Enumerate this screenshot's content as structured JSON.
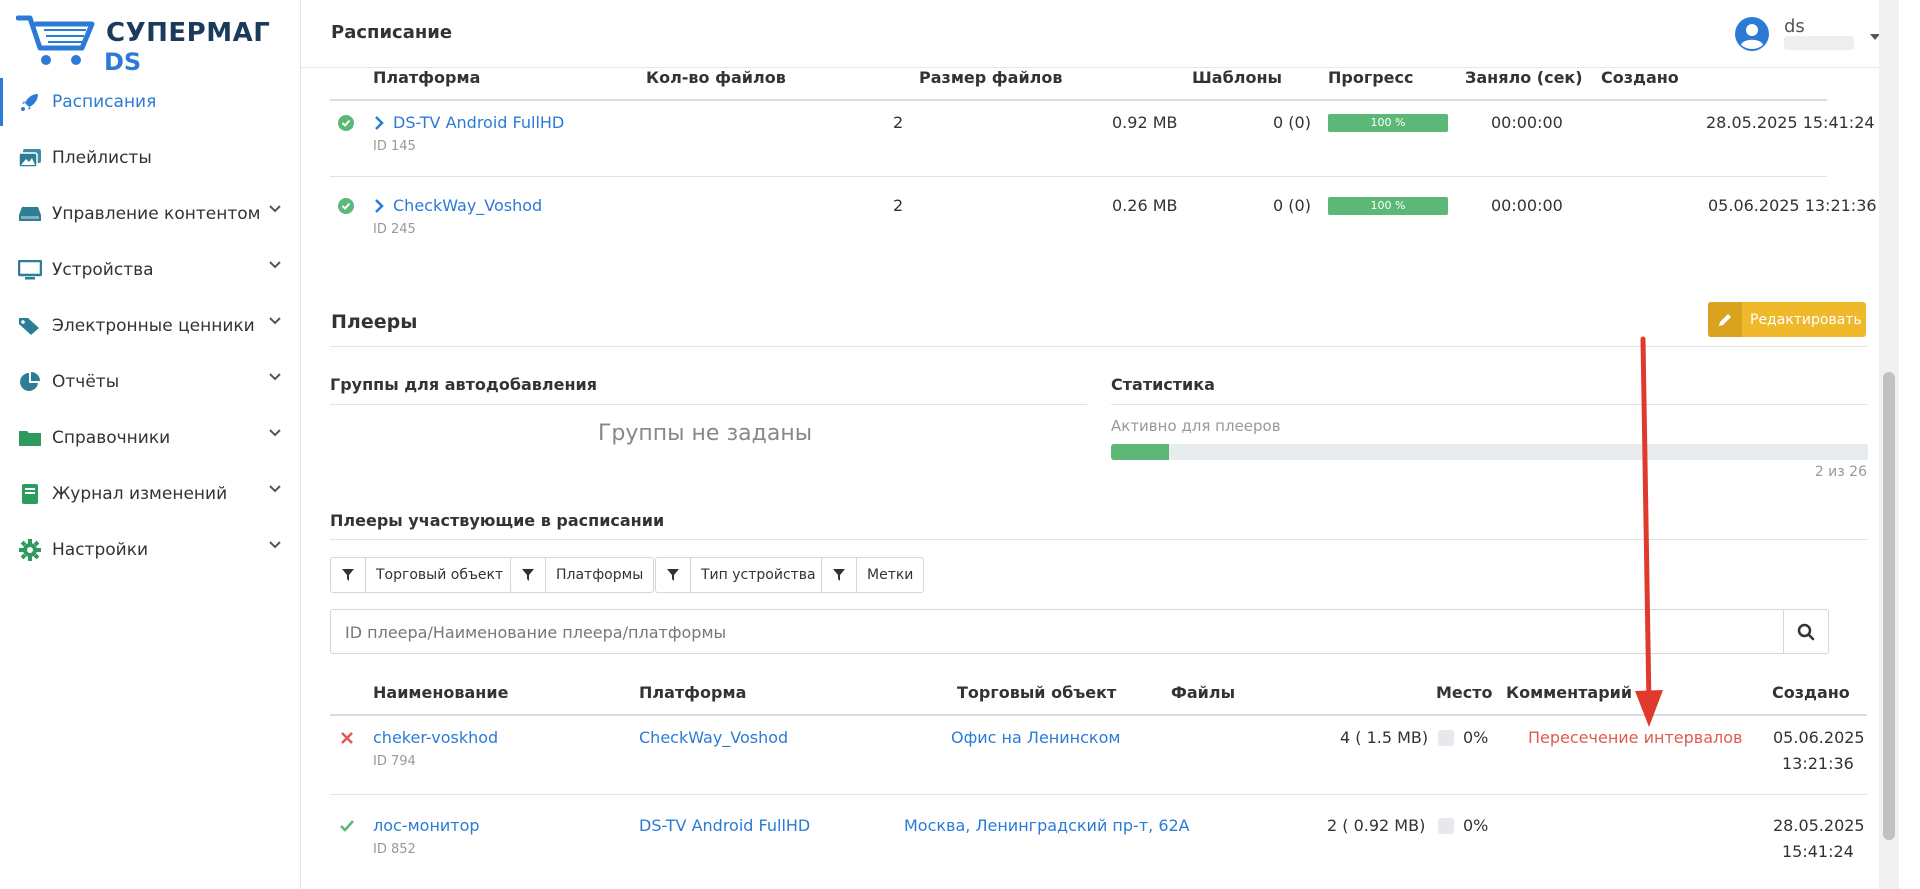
{
  "app": {
    "logo_title": "СУПЕРМАГ",
    "logo_sub": "DS"
  },
  "sidebar": {
    "items": [
      {
        "label": "Расписания",
        "icon": "rocket-icon",
        "active": true,
        "expandable": false
      },
      {
        "label": "Плейлисты",
        "icon": "images-icon",
        "expandable": false
      },
      {
        "label": "Управление контентом",
        "icon": "hdd-icon",
        "expandable": true
      },
      {
        "label": "Устройства",
        "icon": "monitor-icon",
        "expandable": true
      },
      {
        "label": "Электронные ценники",
        "icon": "tags-icon",
        "expandable": true
      },
      {
        "label": "Отчёты",
        "icon": "pie-chart-icon",
        "expandable": true
      },
      {
        "label": "Справочники",
        "icon": "folder-icon",
        "expandable": true
      },
      {
        "label": "Журнал изменений",
        "icon": "book-icon",
        "expandable": true
      },
      {
        "label": "Настройки",
        "icon": "gear-icon",
        "expandable": true
      }
    ]
  },
  "header": {
    "title": "Расписание",
    "user_name": "ds"
  },
  "platforms_table": {
    "columns": [
      "Платформа",
      "Кол-во файлов",
      "Размер файлов",
      "Шаблоны",
      "Прогресс",
      "Заняло (сек)",
      "Создано"
    ],
    "rows": [
      {
        "name": "DS-TV Android FullHD",
        "id": "ID 145",
        "files": "2",
        "size": "0.92 MB",
        "templates": "0 (0)",
        "progress": "100 %",
        "progress_value": 100,
        "elapsed": "00:00:00",
        "created": "28.05.2025 15:41:24"
      },
      {
        "name": "CheckWay_Voshod",
        "id": "ID 245",
        "files": "2",
        "size": "0.26 MB",
        "templates": "0 (0)",
        "progress": "100 %",
        "progress_value": 100,
        "elapsed": "00:00:00",
        "created": "05.06.2025 13:21:36"
      }
    ]
  },
  "players": {
    "title": "Плееры",
    "edit_label": "Редактировать",
    "groups_title": "Группы для автодобавления",
    "groups_empty": "Группы не заданы",
    "stats_title": "Статистика",
    "stats_label": "Активно для плееров",
    "stats_count": "2 из 26",
    "stats_active": 2,
    "stats_total": 26,
    "participants_title": "Плееры участвующие в расписании",
    "filters": [
      "Торговый объект",
      "Платформы",
      "Тип устройства",
      "Метки"
    ],
    "search_placeholder": "ID плеера/Наименование плеера/платформы",
    "columns": [
      "Наименование",
      "Платформа",
      "Торговый объект",
      "Файлы",
      "Место",
      "Комментарий",
      "Создано"
    ],
    "rows": [
      {
        "status": "error",
        "name": "cheker-voskhod",
        "id": "ID 794",
        "platform": "CheckWay_Voshod",
        "object": "Офис на Ленинском",
        "files": "4 ( 1.5 MB)",
        "place": "0%",
        "comment": "Пересечение интервалов",
        "created_date": "05.06.2025",
        "created_time": "13:21:36"
      },
      {
        "status": "ok",
        "name": "лос-монитор",
        "id": "ID 852",
        "platform": "DS-TV Android FullHD",
        "object": "Москва, Ленинградский пр-т, 62А",
        "files": "2 ( 0.92 MB)",
        "place": "0%",
        "comment": "",
        "created_date": "28.05.2025",
        "created_time": "15:41:24"
      }
    ]
  },
  "colors": {
    "accent": "#2b7bd6",
    "success": "#5cb877",
    "warning": "#f0b92b",
    "danger": "#e05a4f"
  }
}
